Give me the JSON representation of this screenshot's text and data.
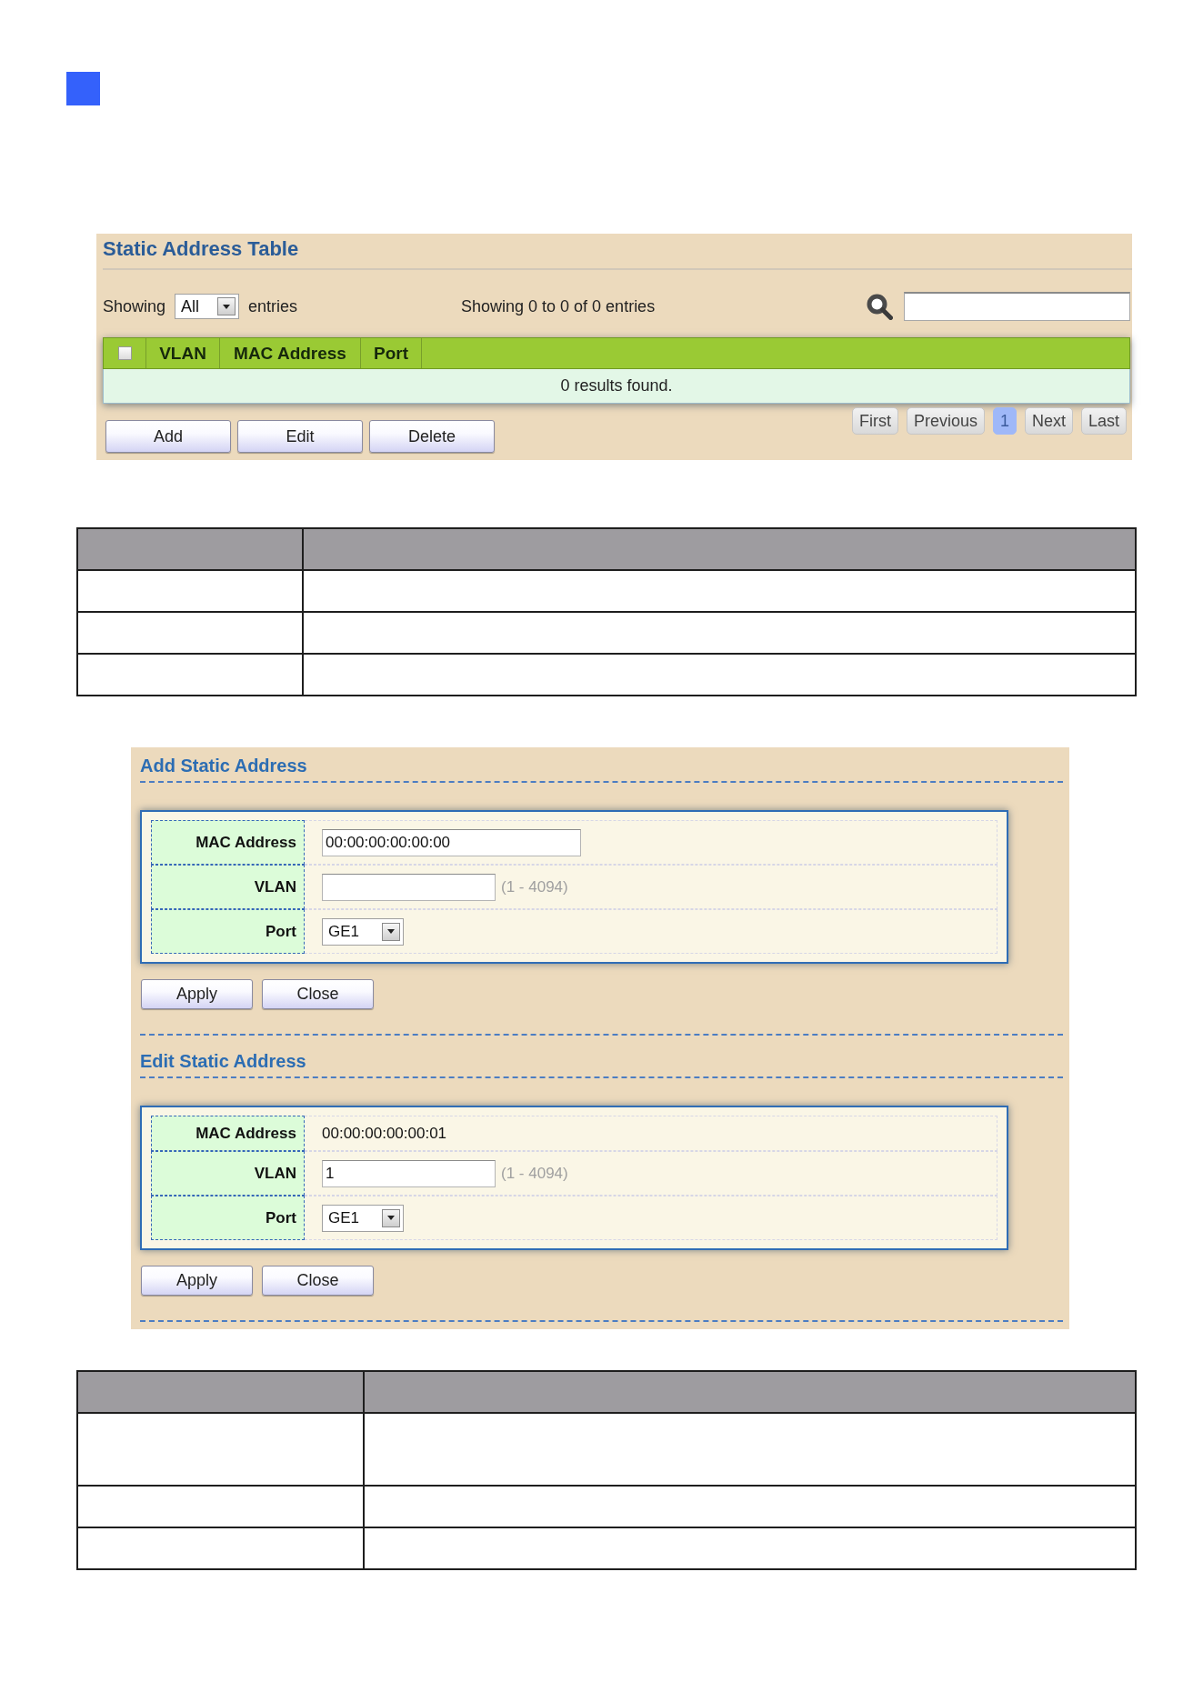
{
  "static_address_table": {
    "title": "Static Address Table",
    "showing_label": "Showing",
    "page_size": "All",
    "entries_label": "entries",
    "summary": "Showing 0 to 0 of 0 entries",
    "select_all": {
      "checked": false
    },
    "columns": [
      "VLAN",
      "MAC Address",
      "Port"
    ],
    "empty_message": "0 results found.",
    "buttons": [
      "Add",
      "Edit",
      "Delete"
    ],
    "pagination": [
      {
        "label": "First",
        "selected": false
      },
      {
        "label": "Previous",
        "selected": false
      },
      {
        "label": "1",
        "selected": true
      },
      {
        "label": "Next",
        "selected": false
      },
      {
        "label": "Last",
        "selected": false
      }
    ]
  },
  "table_1": {
    "rows": [
      {
        "kind": "single"
      },
      {
        "kind": "single"
      },
      {
        "kind": "single"
      }
    ]
  },
  "add_static_address": {
    "title": "Add Static Address",
    "fields": [
      {
        "kind": "input",
        "label": "MAC Address",
        "value": "00:00:00:00:00:00"
      },
      {
        "kind": "input",
        "label": "VLAN",
        "range": "(1 - 4094)"
      },
      {
        "kind": "select",
        "label": "Port",
        "value": "GE1"
      }
    ],
    "buttons": [
      "Apply",
      "Close"
    ]
  },
  "edit_static_address": {
    "title": "Edit Static Address",
    "fields": [
      {
        "kind": "text",
        "label": "MAC Address",
        "value": "00:00:00:00:00:01"
      },
      {
        "kind": "input",
        "label": "VLAN",
        "value": "1",
        "range": "(1 - 4094)"
      },
      {
        "kind": "select",
        "label": "Port",
        "value": "GE1"
      }
    ],
    "buttons": [
      "Apply",
      "Close"
    ]
  },
  "table_2": {
    "rows": [
      {
        "kind": "double"
      },
      {
        "kind": "single"
      },
      {
        "kind": "single"
      }
    ]
  }
}
